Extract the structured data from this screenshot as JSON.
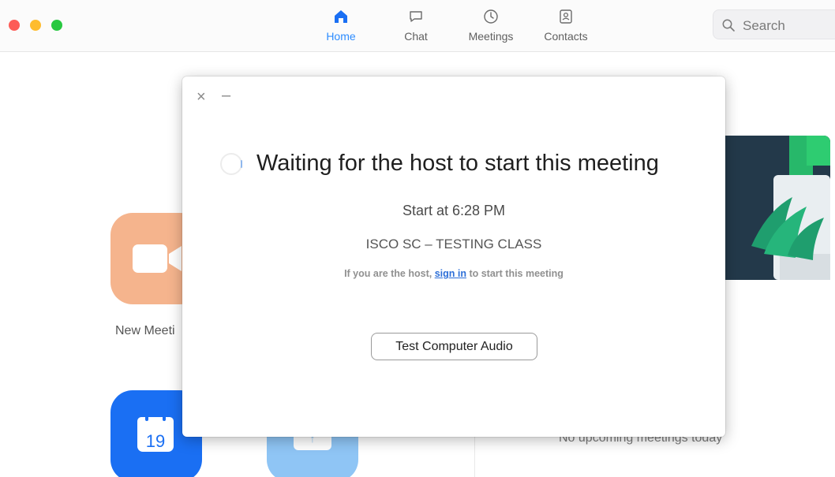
{
  "nav": {
    "tabs": [
      {
        "label": "Home",
        "icon": "home-icon",
        "active": true
      },
      {
        "label": "Chat",
        "icon": "chat-icon",
        "active": false
      },
      {
        "label": "Meetings",
        "icon": "clock-icon",
        "active": false
      },
      {
        "label": "Contacts",
        "icon": "contacts-icon",
        "active": false
      }
    ]
  },
  "search": {
    "placeholder": "Search"
  },
  "home": {
    "new_meeting_label": "New Meeti",
    "calendar_day": "19",
    "share_glyph": "↑",
    "no_upcoming": "No upcoming meetings today"
  },
  "modal": {
    "close_glyph": "×",
    "minimize_glyph": "–",
    "title": "Waiting for the host to start this meeting",
    "start_time": "Start at 6:28 PM",
    "topic": "ISCO SC – TESTING CLASS",
    "hint_prefix": "If you are the host, ",
    "hint_link": "sign in",
    "hint_suffix": " to start this meeting",
    "button": "Test Computer Audio"
  },
  "colors": {
    "accent": "#2d8cff",
    "new_meeting_tile": "#f5b48d",
    "schedule_tile": "#1a6ff3",
    "share_tile": "#8fc5f5",
    "banner": "#23394a"
  }
}
